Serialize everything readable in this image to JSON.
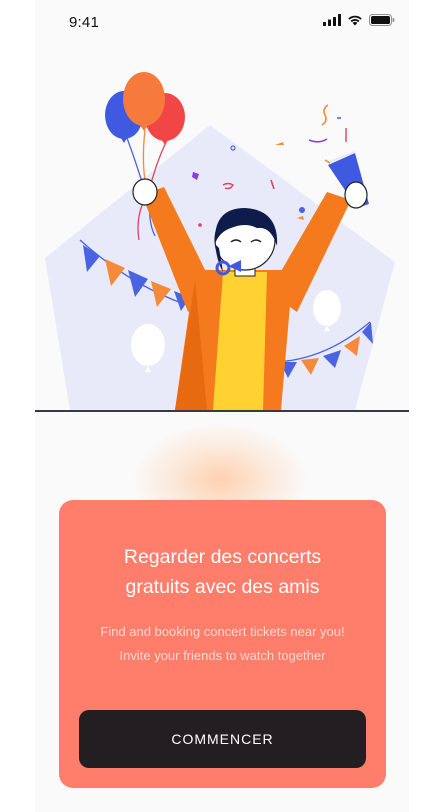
{
  "status_bar": {
    "time": "9:41",
    "icons": [
      "signal-icon",
      "wifi-icon",
      "battery-icon"
    ]
  },
  "illustration": {
    "subject": "party-celebration-illustration"
  },
  "card": {
    "title_line1": "Regarder des concerts",
    "title_line2": "gratuits avec des amis",
    "subtitle_line1": "Find and booking concert tickets near you!",
    "subtitle_line2": "Invite your friends to watch together",
    "button_label": "COMMENCER"
  },
  "colors": {
    "card_background": "#ff7e6b",
    "button_background": "#221e22",
    "screen_background": "#fafafa"
  }
}
